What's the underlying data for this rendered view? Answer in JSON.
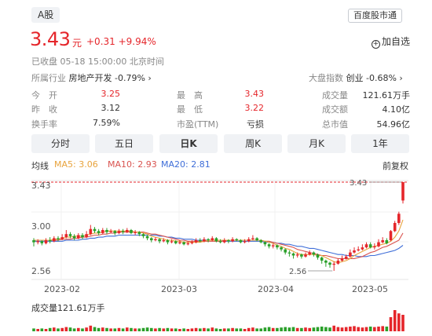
{
  "header": {
    "tag": "A股",
    "app_tag": "百度股市通",
    "price": "3.43",
    "unit": "元",
    "change": "+0.31 +9.94%",
    "watch_label": "加自选",
    "status": "已收盘  05-18 15:00:00  北京时间"
  },
  "industry": {
    "label": "所属行业",
    "name": "房地产开发",
    "change": "-0.79%",
    "arrow": "›"
  },
  "market": {
    "label": "大盘指数",
    "name": "创业",
    "change": "-0.68%",
    "arrow": "›"
  },
  "stats": [
    {
      "label": "今　开",
      "value": "3.25",
      "color": "red"
    },
    {
      "label": "最　高",
      "value": "3.43",
      "color": "red"
    },
    {
      "label": "成交量",
      "value": "121.61万手",
      "color": "dark"
    },
    {
      "label": "昨　收",
      "value": "3.12",
      "color": "dark"
    },
    {
      "label": "最　低",
      "value": "3.22",
      "color": "red"
    },
    {
      "label": "成交额",
      "value": "4.10亿",
      "color": "dark"
    },
    {
      "label": "换手率",
      "value": "7.59%",
      "color": "dark"
    },
    {
      "label": "市盈(TTM)",
      "value": "亏损",
      "color": "dark"
    },
    {
      "label": "总市值",
      "value": "54.96亿",
      "color": "dark"
    }
  ],
  "tabs": [
    "分时",
    "五日",
    "日K",
    "周K",
    "月K",
    "1年"
  ],
  "active_tab": "日K",
  "legend": {
    "title": "均线",
    "ma5": "MA5: 3.06",
    "ma10": "MA10: 2.93",
    "ma20": "MA20: 2.81",
    "fuquan": "前复权"
  },
  "volume_label": "成交量121.61万手",
  "colors": {
    "up": "#e5262b",
    "down": "#2aa02a",
    "ma5": "#e8a33c",
    "ma10": "#d9534f",
    "ma20": "#3f6ed8",
    "tab_bg": "#f0f2f5"
  },
  "chart_data": {
    "type": "candlestick",
    "y_ticks": [
      "3.43",
      "3.00",
      "2.56"
    ],
    "ylim": [
      2.56,
      3.43
    ],
    "x_ticks": [
      "2023-02",
      "2023-03",
      "2023-04",
      "2023-05"
    ],
    "annotations": {
      "max": "3.43",
      "min": "2.56"
    },
    "candles": [
      [
        2.86,
        2.84,
        2.88,
        2.8
      ],
      [
        2.84,
        2.85,
        2.87,
        2.82
      ],
      [
        2.85,
        2.83,
        2.86,
        2.81
      ],
      [
        2.83,
        2.86,
        2.88,
        2.82
      ],
      [
        2.86,
        2.85,
        2.89,
        2.83
      ],
      [
        2.85,
        2.88,
        2.9,
        2.84
      ],
      [
        2.88,
        2.87,
        2.9,
        2.85
      ],
      [
        2.87,
        2.89,
        2.92,
        2.86
      ],
      [
        2.89,
        2.92,
        2.96,
        2.88
      ],
      [
        2.92,
        2.9,
        2.94,
        2.88
      ],
      [
        2.9,
        2.88,
        2.92,
        2.86
      ],
      [
        2.88,
        2.91,
        2.93,
        2.87
      ],
      [
        2.91,
        2.89,
        2.93,
        2.87
      ],
      [
        2.89,
        2.92,
        2.95,
        2.88
      ],
      [
        2.92,
        2.97,
        3.01,
        2.91
      ],
      [
        2.97,
        2.95,
        2.99,
        2.93
      ],
      [
        2.95,
        2.93,
        2.97,
        2.91
      ],
      [
        2.93,
        2.96,
        2.98,
        2.92
      ],
      [
        2.96,
        2.94,
        2.98,
        2.92
      ],
      [
        2.94,
        2.95,
        2.97,
        2.93
      ],
      [
        2.95,
        2.93,
        2.96,
        2.91
      ],
      [
        2.93,
        2.95,
        2.97,
        2.92
      ],
      [
        2.95,
        2.94,
        2.97,
        2.92
      ],
      [
        2.94,
        2.96,
        2.98,
        2.93
      ],
      [
        2.96,
        2.93,
        2.97,
        2.92
      ],
      [
        2.93,
        2.94,
        2.96,
        2.91
      ],
      [
        2.94,
        2.92,
        2.95,
        2.9
      ],
      [
        2.92,
        2.9,
        2.93,
        2.88
      ],
      [
        2.9,
        2.88,
        2.91,
        2.86
      ],
      [
        2.88,
        2.86,
        2.89,
        2.84
      ],
      [
        2.86,
        2.87,
        2.89,
        2.85
      ],
      [
        2.87,
        2.85,
        2.88,
        2.83
      ],
      [
        2.85,
        2.86,
        2.88,
        2.84
      ],
      [
        2.86,
        2.84,
        2.87,
        2.82
      ],
      [
        2.84,
        2.85,
        2.87,
        2.83
      ],
      [
        2.85,
        2.83,
        2.86,
        2.82
      ],
      [
        2.83,
        2.84,
        2.86,
        2.82
      ],
      [
        2.84,
        2.82,
        2.85,
        2.81
      ],
      [
        2.82,
        2.83,
        2.85,
        2.81
      ],
      [
        2.83,
        2.84,
        2.86,
        2.82
      ],
      [
        2.84,
        2.86,
        2.88,
        2.83
      ],
      [
        2.86,
        2.85,
        2.88,
        2.84
      ],
      [
        2.85,
        2.87,
        2.89,
        2.84
      ],
      [
        2.87,
        2.86,
        2.88,
        2.84
      ],
      [
        2.86,
        2.88,
        2.9,
        2.85
      ],
      [
        2.88,
        2.85,
        2.89,
        2.84
      ],
      [
        2.85,
        2.84,
        2.87,
        2.83
      ],
      [
        2.84,
        2.86,
        2.88,
        2.83
      ],
      [
        2.86,
        2.85,
        2.87,
        2.83
      ],
      [
        2.85,
        2.87,
        2.89,
        2.84
      ],
      [
        2.87,
        2.86,
        2.88,
        2.85
      ],
      [
        2.86,
        2.84,
        2.87,
        2.83
      ],
      [
        2.84,
        2.85,
        2.87,
        2.83
      ],
      [
        2.85,
        2.87,
        2.89,
        2.84
      ],
      [
        2.87,
        2.88,
        2.91,
        2.86
      ],
      [
        2.88,
        2.86,
        2.89,
        2.85
      ],
      [
        2.86,
        2.84,
        2.87,
        2.83
      ],
      [
        2.84,
        2.82,
        2.85,
        2.8
      ],
      [
        2.82,
        2.8,
        2.83,
        2.78
      ],
      [
        2.8,
        2.81,
        2.83,
        2.78
      ],
      [
        2.81,
        2.79,
        2.82,
        2.77
      ],
      [
        2.79,
        2.77,
        2.8,
        2.75
      ],
      [
        2.77,
        2.74,
        2.78,
        2.72
      ],
      [
        2.74,
        2.73,
        2.76,
        2.7
      ],
      [
        2.73,
        2.71,
        2.74,
        2.68
      ],
      [
        2.71,
        2.72,
        2.74,
        2.69
      ],
      [
        2.72,
        2.7,
        2.73,
        2.68
      ],
      [
        2.7,
        2.72,
        2.74,
        2.69
      ],
      [
        2.72,
        2.74,
        2.76,
        2.71
      ],
      [
        2.74,
        2.72,
        2.75,
        2.7
      ],
      [
        2.72,
        2.69,
        2.73,
        2.67
      ],
      [
        2.69,
        2.66,
        2.7,
        2.63
      ],
      [
        2.66,
        2.64,
        2.67,
        2.6
      ],
      [
        2.64,
        2.62,
        2.65,
        2.59
      ],
      [
        2.62,
        2.63,
        2.65,
        2.56
      ],
      [
        2.63,
        2.66,
        2.68,
        2.62
      ],
      [
        2.66,
        2.68,
        2.71,
        2.65
      ],
      [
        2.68,
        2.7,
        2.72,
        2.67
      ],
      [
        2.7,
        2.74,
        2.77,
        2.69
      ],
      [
        2.74,
        2.76,
        2.79,
        2.73
      ],
      [
        2.76,
        2.77,
        2.8,
        2.75
      ],
      [
        2.77,
        2.79,
        2.82,
        2.76
      ],
      [
        2.79,
        2.82,
        2.84,
        2.78
      ],
      [
        2.82,
        2.79,
        2.84,
        2.78
      ],
      [
        2.79,
        2.8,
        2.83,
        2.77
      ],
      [
        2.8,
        2.84,
        2.87,
        2.79
      ],
      [
        2.84,
        2.86,
        2.89,
        2.83
      ],
      [
        2.86,
        2.83,
        2.88,
        2.82
      ],
      [
        2.86,
        2.95,
        2.96,
        2.85
      ],
      [
        2.95,
        3.03,
        3.05,
        2.94
      ],
      [
        3.03,
        3.12,
        3.14,
        3.01
      ],
      [
        3.25,
        3.43,
        3.43,
        3.22
      ]
    ],
    "ma5": [
      2.86,
      2.86,
      2.86,
      2.86,
      2.86,
      2.87,
      2.87,
      2.88,
      2.89,
      2.89,
      2.9,
      2.9,
      2.9,
      2.91,
      2.92,
      2.93,
      2.93,
      2.94,
      2.95,
      2.95,
      2.95,
      2.95,
      2.95,
      2.95,
      2.95,
      2.94,
      2.94,
      2.93,
      2.92,
      2.9,
      2.89,
      2.88,
      2.87,
      2.86,
      2.86,
      2.85,
      2.85,
      2.84,
      2.84,
      2.84,
      2.84,
      2.84,
      2.85,
      2.86,
      2.86,
      2.86,
      2.86,
      2.86,
      2.86,
      2.86,
      2.86,
      2.86,
      2.86,
      2.86,
      2.86,
      2.86,
      2.86,
      2.85,
      2.84,
      2.83,
      2.81,
      2.8,
      2.78,
      2.77,
      2.75,
      2.73,
      2.72,
      2.72,
      2.72,
      2.72,
      2.71,
      2.71,
      2.69,
      2.67,
      2.65,
      2.64,
      2.65,
      2.66,
      2.68,
      2.71,
      2.73,
      2.75,
      2.77,
      2.79,
      2.8,
      2.81,
      2.82,
      2.83,
      2.85,
      2.89,
      2.95,
      3.06
    ],
    "ma10": [
      2.86,
      2.86,
      2.86,
      2.86,
      2.86,
      2.86,
      2.86,
      2.87,
      2.87,
      2.87,
      2.88,
      2.88,
      2.89,
      2.89,
      2.9,
      2.91,
      2.91,
      2.92,
      2.92,
      2.93,
      2.93,
      2.94,
      2.94,
      2.94,
      2.94,
      2.94,
      2.94,
      2.94,
      2.93,
      2.92,
      2.92,
      2.91,
      2.9,
      2.89,
      2.88,
      2.87,
      2.86,
      2.86,
      2.85,
      2.85,
      2.85,
      2.85,
      2.85,
      2.85,
      2.85,
      2.85,
      2.85,
      2.85,
      2.86,
      2.86,
      2.86,
      2.86,
      2.86,
      2.86,
      2.86,
      2.86,
      2.86,
      2.85,
      2.85,
      2.84,
      2.83,
      2.82,
      2.81,
      2.8,
      2.79,
      2.77,
      2.76,
      2.75,
      2.74,
      2.73,
      2.72,
      2.71,
      2.71,
      2.7,
      2.69,
      2.68,
      2.68,
      2.68,
      2.68,
      2.68,
      2.69,
      2.7,
      2.72,
      2.74,
      2.75,
      2.77,
      2.79,
      2.8,
      2.82,
      2.84,
      2.86,
      2.93
    ],
    "ma20": [
      2.85,
      2.85,
      2.85,
      2.85,
      2.85,
      2.85,
      2.85,
      2.85,
      2.86,
      2.86,
      2.86,
      2.86,
      2.87,
      2.87,
      2.88,
      2.88,
      2.89,
      2.89,
      2.9,
      2.9,
      2.9,
      2.91,
      2.91,
      2.91,
      2.91,
      2.91,
      2.91,
      2.91,
      2.91,
      2.91,
      2.91,
      2.9,
      2.9,
      2.89,
      2.89,
      2.88,
      2.88,
      2.87,
      2.87,
      2.87,
      2.86,
      2.86,
      2.86,
      2.86,
      2.86,
      2.86,
      2.86,
      2.85,
      2.85,
      2.85,
      2.85,
      2.85,
      2.85,
      2.85,
      2.85,
      2.85,
      2.85,
      2.84,
      2.84,
      2.84,
      2.83,
      2.83,
      2.82,
      2.82,
      2.81,
      2.8,
      2.8,
      2.79,
      2.78,
      2.78,
      2.77,
      2.76,
      2.75,
      2.74,
      2.73,
      2.72,
      2.72,
      2.71,
      2.71,
      2.71,
      2.7,
      2.7,
      2.7,
      2.71,
      2.71,
      2.72,
      2.73,
      2.74,
      2.75,
      2.76,
      2.78,
      2.81
    ],
    "volume": [
      6,
      5,
      6,
      5,
      7,
      8,
      6,
      7,
      9,
      8,
      6,
      7,
      6,
      8,
      12,
      9,
      7,
      8,
      7,
      6,
      6,
      7,
      6,
      8,
      7,
      6,
      6,
      7,
      8,
      7,
      6,
      7,
      6,
      7,
      6,
      6,
      5,
      6,
      5,
      6,
      7,
      6,
      7,
      6,
      8,
      6,
      5,
      6,
      6,
      7,
      6,
      6,
      5,
      7,
      8,
      6,
      6,
      8,
      9,
      7,
      7,
      8,
      9,
      8,
      9,
      7,
      7,
      8,
      7,
      8,
      9,
      10,
      9,
      8,
      12,
      9,
      8,
      9,
      10,
      11,
      9,
      8,
      9,
      10,
      9,
      10,
      11,
      10,
      30,
      45,
      38,
      35
    ]
  }
}
